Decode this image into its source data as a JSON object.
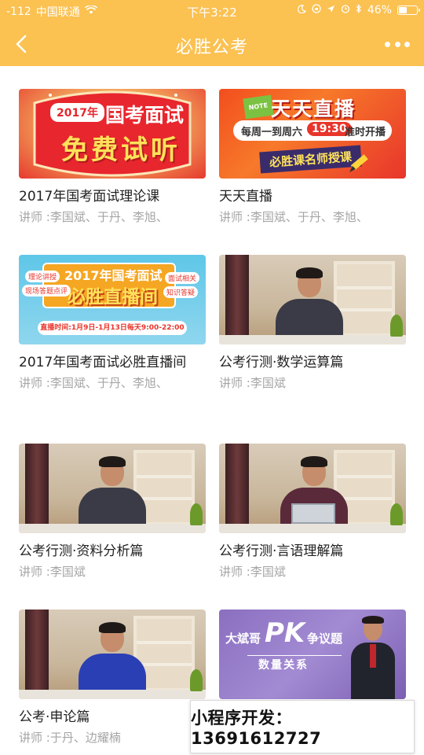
{
  "status_bar": {
    "signal": "-112",
    "carrier": "中国联通",
    "time": "下午3:22",
    "battery": "46%",
    "battery_level": 0.46
  },
  "nav": {
    "title": "必胜公考"
  },
  "courses": [
    {
      "title": "2017年国考面试理论课",
      "teacher": "讲师 :李国斌、于丹、李旭、",
      "banner": {
        "badge": "2017年",
        "line1": "国考面试",
        "line2": "免费试听"
      }
    },
    {
      "title": "天天直播",
      "teacher": "讲师 :李国斌、于丹、李旭、",
      "banner": {
        "tag": "NOTE",
        "headline": "天天直播",
        "schedule_pre": "每周一到周六",
        "schedule_time": "19:30",
        "schedule_post": "准时开播",
        "sub": "必胜课名师授课"
      }
    },
    {
      "title": "2017年国考面试必胜直播间",
      "teacher": "讲师 :李国斌、于丹、李旭、",
      "banner": {
        "line1": "2017年国考面试",
        "line2": "必胜直播间",
        "left_tag1": "理论讲授",
        "left_tag2": "现场答题点评",
        "right_tag1": "面试相关",
        "right_tag2": "知识答疑",
        "date": "直播时间:1月9日-1月13日每天9:00-22:00"
      }
    },
    {
      "title": "公考行测·数学运算篇",
      "teacher": "讲师 :李国斌"
    },
    {
      "title": "公考行测·资料分析篇",
      "teacher": "讲师 :李国斌"
    },
    {
      "title": "公考行测·言语理解篇",
      "teacher": "讲师 :李国斌"
    },
    {
      "title": "公考·申论篇",
      "teacher": "讲师 :于丹、边耀楠"
    },
    {
      "title": "",
      "teacher": "",
      "banner": {
        "name": "大斌哥",
        "pk": "PK",
        "topic": "争议题",
        "sub": "数量关系"
      }
    }
  ],
  "watermark": {
    "text": "小程序开发：13691612727"
  },
  "colors": {
    "header": "#fbc151",
    "title_text": "#222222",
    "teacher_text": "#a5a5a5"
  }
}
